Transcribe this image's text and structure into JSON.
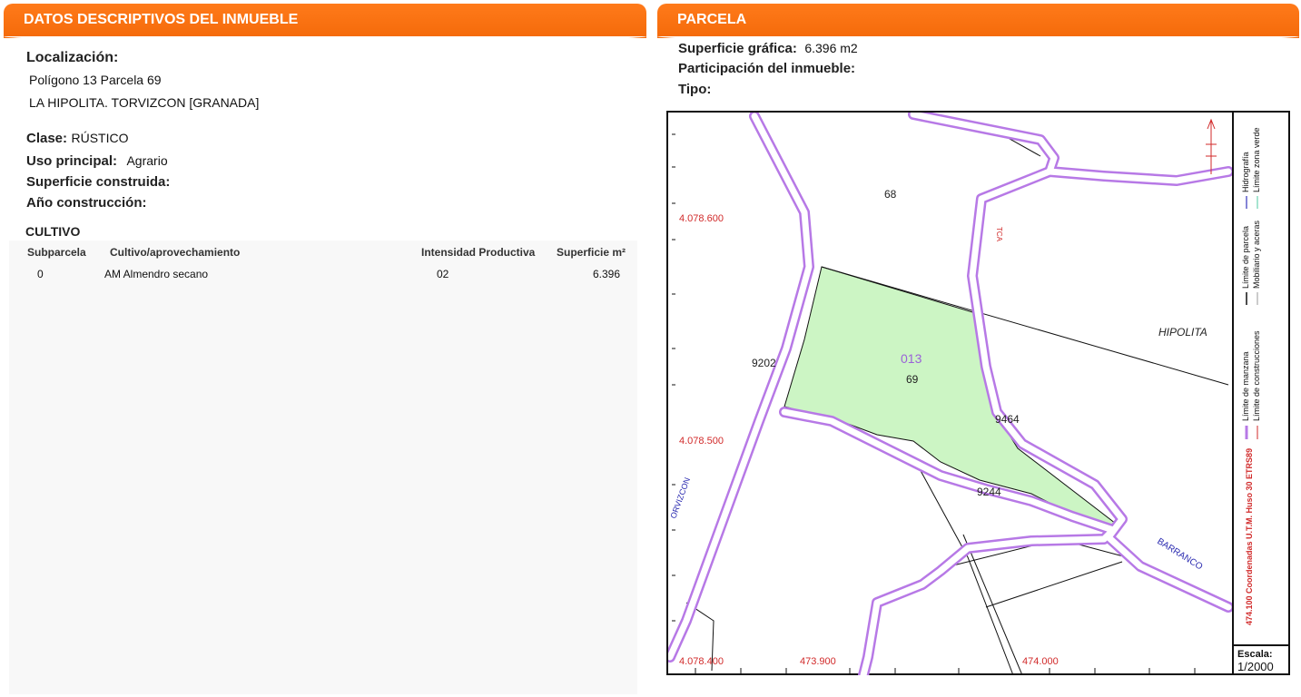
{
  "left": {
    "header": "DATOS DESCRIPTIVOS DEL INMUEBLE",
    "localizacion_label": "Localización:",
    "address_line1": "Polígono 13 Parcela 69",
    "address_line2": "LA HIPOLITA. TORVIZCON [GRANADA]",
    "clase_label": "Clase:",
    "clase_value": "RÚSTICO",
    "uso_label": "Uso principal:",
    "uso_value": "Agrario",
    "superficie_label": "Superficie construida:",
    "anio_label": "Año construcción:",
    "cultivo_title": "CULTIVO",
    "table": {
      "headers": [
        "Subparcela",
        "Cultivo/aprovechamiento",
        "Intensidad Productiva",
        "Superficie m²"
      ],
      "rows": [
        [
          "0",
          "AM Almendro secano",
          "02",
          "6.396"
        ]
      ]
    }
  },
  "right": {
    "header": "PARCELA",
    "superficie_label": "Superficie gráfica:",
    "superficie_value": "6.396 m2",
    "participacion_label": "Participación del inmueble:",
    "tipo_label": "Tipo:",
    "map": {
      "coords": {
        "y1": "4.078.600",
        "y2": "4.078.500",
        "y3": "4.078.400",
        "x1": "473.900",
        "x2": "474.000"
      },
      "labels": {
        "p68": "68",
        "p013": "013",
        "p69": "69",
        "p9202": "9202",
        "p9464": "9464",
        "p9244": "9244",
        "hipolita": "HIPOLITA",
        "barranco": "BARRANCO",
        "torvizcon": "ORVIZCON",
        "tca": "TCA"
      },
      "legend": {
        "col1": [
          "Límite de manzana",
          "Límite de parcela",
          "Hidrografía"
        ],
        "col2": [
          "Límite de construcciones",
          "Mobiliario y aceras",
          "Límite zona verde"
        ],
        "coord_note": "474.100 Coordenadas U.T.M. Huso 30 ETRS89"
      },
      "scale_label": "Escala:",
      "scale_value": "1/2000",
      "colors": {
        "road": "#b779e6",
        "parcel": "#ccf5c4",
        "coord": "#d12a2a",
        "place": "#2a2ab0"
      }
    }
  }
}
